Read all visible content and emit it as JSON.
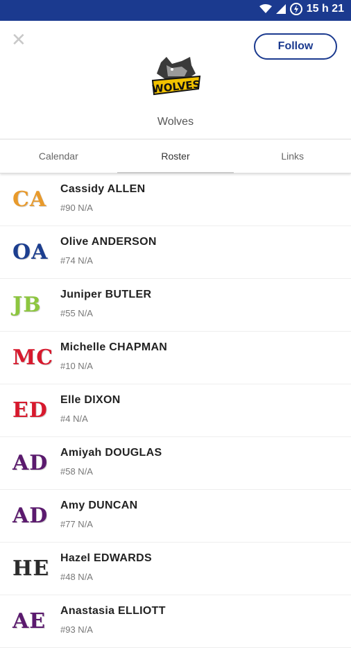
{
  "status": {
    "time": "15 h 21"
  },
  "header": {
    "close_icon": "close-icon",
    "follow_label": "Follow",
    "team_name": "Wolves",
    "logo_text": "WOLVES"
  },
  "tabs": [
    {
      "label": "Calendar",
      "active": false
    },
    {
      "label": "Roster",
      "active": true
    },
    {
      "label": "Links",
      "active": false
    }
  ],
  "roster": [
    {
      "initials": "CA",
      "name": "Cassidy ALLEN",
      "detail": "#90 N/A",
      "color": "#e89a2c"
    },
    {
      "initials": "OA",
      "name": "Olive ANDERSON",
      "detail": "#74 N/A",
      "color": "#1c3e8f"
    },
    {
      "initials": "JB",
      "name": "Juniper BUTLER",
      "detail": "#55 N/A",
      "color": "#8dc63f"
    },
    {
      "initials": "MC",
      "name": "Michelle CHAPMAN",
      "detail": "#10 N/A",
      "color": "#d7192d"
    },
    {
      "initials": "ED",
      "name": "Elle DIXON",
      "detail": "#4 N/A",
      "color": "#d7192d"
    },
    {
      "initials": "AD",
      "name": "Amiyah DOUGLAS",
      "detail": "#58 N/A",
      "color": "#5b1a6e"
    },
    {
      "initials": "AD",
      "name": "Amy DUNCAN",
      "detail": "#77 N/A",
      "color": "#5b1a6e"
    },
    {
      "initials": "HE",
      "name": "Hazel EDWARDS",
      "detail": "#48 N/A",
      "color": "#2b2b2b"
    },
    {
      "initials": "AE",
      "name": "Anastasia ELLIOTT",
      "detail": "#93 N/A",
      "color": "#5b1a6e"
    }
  ]
}
